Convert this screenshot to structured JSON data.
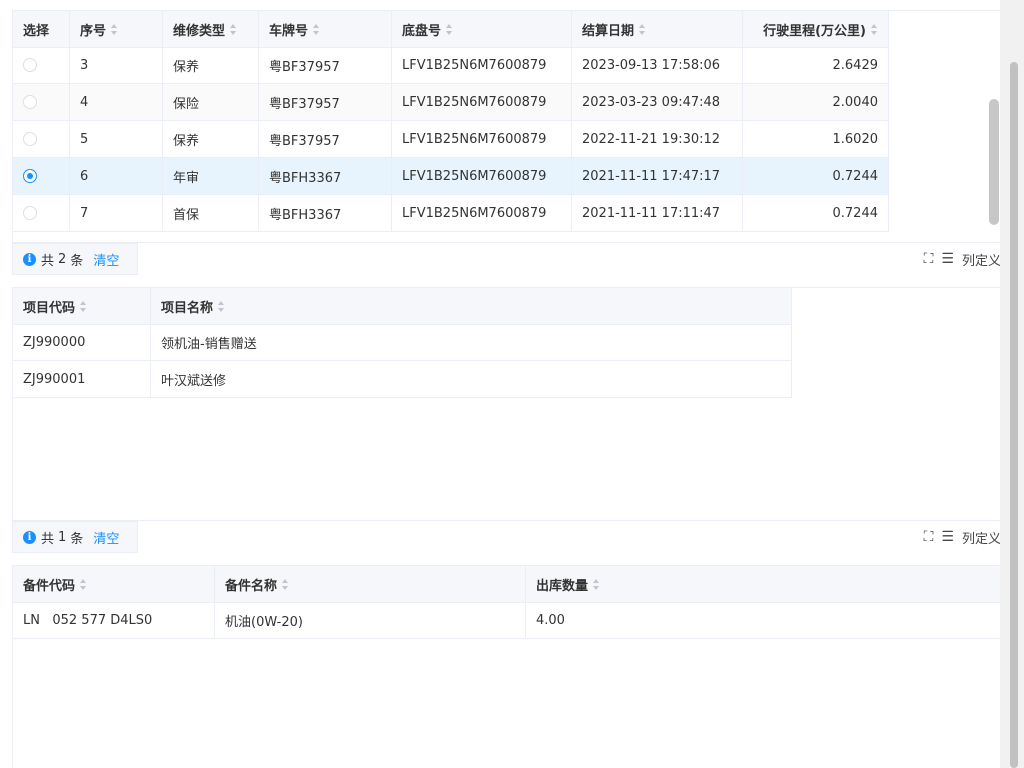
{
  "vehicle_table": {
    "headers": [
      "选择",
      "序号",
      "维修类型",
      "车牌号",
      "底盘号",
      "结算日期",
      "行驶里程(万公里)"
    ],
    "rows": [
      {
        "seq": "3",
        "type": "保养",
        "plate": "粤BF37957",
        "vin": "LFV1B25N6M7600879",
        "date": "2023-09-13 17:58:06",
        "mileage": "2.6429",
        "selected": false
      },
      {
        "seq": "4",
        "type": "保险",
        "plate": "粤BF37957",
        "vin": "LFV1B25N6M7600879",
        "date": "2023-03-23 09:47:48",
        "mileage": "2.0040",
        "selected": false
      },
      {
        "seq": "5",
        "type": "保养",
        "plate": "粤BF37957",
        "vin": "LFV1B25N6M7600879",
        "date": "2022-11-21 19:30:12",
        "mileage": "1.6020",
        "selected": false
      },
      {
        "seq": "6",
        "type": "年审",
        "plate": "粤BFH3367",
        "vin": "LFV1B25N6M7600879",
        "date": "2021-11-11 17:47:17",
        "mileage": "0.7244",
        "selected": true
      },
      {
        "seq": "7",
        "type": "首保",
        "plate": "粤BFH3367",
        "vin": "LFV1B25N6M7600879",
        "date": "2021-11-11 17:11:47",
        "mileage": "0.7244",
        "selected": false
      }
    ]
  },
  "project_section": {
    "count_prefix": "共",
    "count": "2",
    "count_suffix": "条",
    "clear_label": "清空",
    "columns_label": "列定义",
    "headers": [
      "项目代码",
      "项目名称"
    ],
    "rows": [
      {
        "code": "ZJ990000",
        "name": "领机油-销售赠送"
      },
      {
        "code": "ZJ990001",
        "name": "叶汉斌送修"
      }
    ]
  },
  "parts_section": {
    "count_prefix": "共",
    "count": "1",
    "count_suffix": "条",
    "clear_label": "清空",
    "columns_label": "列定义",
    "headers": [
      "备件代码",
      "备件名称",
      "出库数量"
    ],
    "rows": [
      {
        "code": "LN   052 577 D4LS0",
        "name": "机油(0W-20)",
        "qty": "4.00"
      }
    ]
  },
  "colors": {
    "accent": "#1890ff",
    "selected_row": "#e8f4fd",
    "header_bg": "#f5f7fa"
  },
  "icons": {
    "info": "info-icon",
    "fullscreen": "fullscreen-icon",
    "list": "list-icon"
  }
}
